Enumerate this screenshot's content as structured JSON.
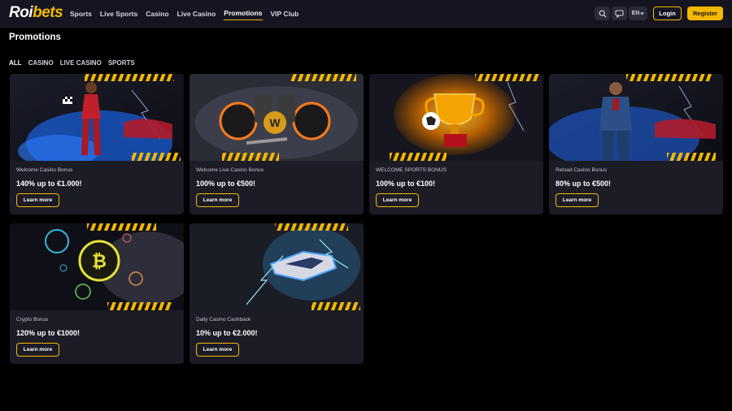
{
  "header": {
    "logo_part1": "Roi",
    "logo_part2": "bets",
    "nav": [
      {
        "label": "Sports"
      },
      {
        "label": "Live Sports"
      },
      {
        "label": "Casino"
      },
      {
        "label": "Live Casino"
      },
      {
        "label": "Promotions",
        "active": true
      },
      {
        "label": "VIP Club"
      }
    ],
    "icons": [
      "search-icon",
      "chat-icon"
    ],
    "language": "EN",
    "login_label": "Login",
    "register_label": "Register"
  },
  "page": {
    "title": "Promotions",
    "filters": [
      {
        "label": "ALL",
        "active": true
      },
      {
        "label": "CASINO"
      },
      {
        "label": "LIVE CASINO"
      },
      {
        "label": "SPORTS"
      }
    ]
  },
  "promotions": [
    {
      "name": "Welcome Casino Bonus",
      "offer": "140% up to €1.000!",
      "cta": "Learn more",
      "image": "racer-woman-image"
    },
    {
      "name": "Welcome Live Casino Bonus",
      "offer": "100% up to €500!",
      "cta": "Learn more",
      "image": "engine-w-image"
    },
    {
      "name": "WELCOME SPORTS BONUS",
      "offer": "100% up to €100!",
      "cta": "Learn more",
      "image": "trophy-image"
    },
    {
      "name": "Reload Casino Bonus",
      "offer": "80% up to €500!",
      "cta": "Learn more",
      "image": "man-denim-image"
    },
    {
      "name": "Crypto Bonus",
      "offer": "120% up to €1000!",
      "cta": "Learn more",
      "image": "crypto-coins-image"
    },
    {
      "name": "Daily Casino Cashback",
      "offer": "10% up to €2.000!",
      "cta": "Learn more",
      "image": "race-car-image"
    }
  ],
  "colors": {
    "accent": "#f5b800",
    "background": "#000000",
    "card": "#1c1c27",
    "header": "#151521"
  }
}
